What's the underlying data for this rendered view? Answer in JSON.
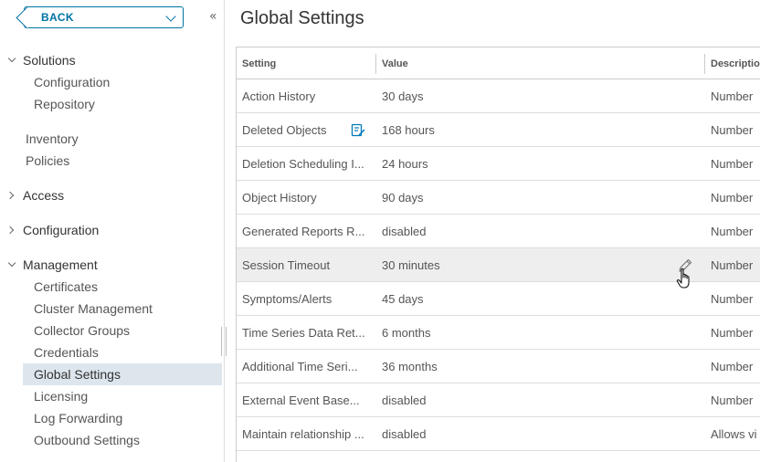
{
  "sidebar": {
    "back_label": "BACK",
    "collapse_icon": "«",
    "groups": {
      "solutions": "Solutions",
      "access": "Access",
      "configuration": "Configuration",
      "management": "Management"
    },
    "solutions_items": [
      "Configuration",
      "Repository"
    ],
    "top_items": [
      "Inventory",
      "Policies"
    ],
    "management_items": [
      "Certificates",
      "Cluster Management",
      "Collector Groups",
      "Credentials",
      "Global Settings",
      "Licensing",
      "Log Forwarding",
      "Outbound Settings"
    ],
    "active_item": "Global Settings"
  },
  "page": {
    "title": "Global Settings"
  },
  "table": {
    "headers": {
      "setting": "Setting",
      "value": "Value",
      "description": "Descriptio"
    },
    "rows": [
      {
        "setting": "Action History",
        "value": "30 days",
        "description": "Number"
      },
      {
        "setting": "Deleted Objects",
        "value": "168 hours",
        "description": "Number"
      },
      {
        "setting": "Deletion Scheduling I...",
        "value": "24 hours",
        "description": "Number"
      },
      {
        "setting": "Object History",
        "value": "90 days",
        "description": "Number"
      },
      {
        "setting": "Generated Reports R...",
        "value": "disabled",
        "description": "Number"
      },
      {
        "setting": "Session Timeout",
        "value": "30 minutes",
        "description": "Number"
      },
      {
        "setting": "Symptoms/Alerts",
        "value": "45 days",
        "description": "Number"
      },
      {
        "setting": "Time Series Data Ret...",
        "value": "6 months",
        "description": "Number"
      },
      {
        "setting": "Additional Time Seri...",
        "value": "36 months",
        "description": "Number"
      },
      {
        "setting": "External Event Base...",
        "value": "disabled",
        "description": "Number"
      },
      {
        "setting": "Maintain relationship ...",
        "value": "disabled",
        "description": "Allows vi"
      }
    ]
  },
  "colors": {
    "accent": "#0072a3",
    "active_bg": "#dde6ed",
    "hover_row": "#eeeeee"
  }
}
